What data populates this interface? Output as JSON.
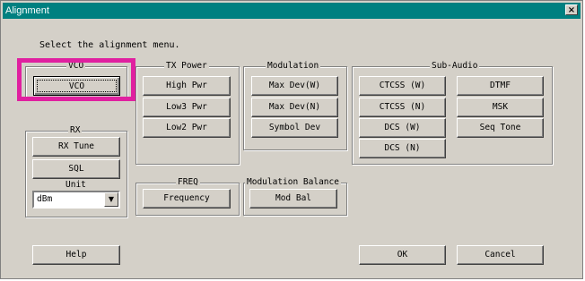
{
  "window": {
    "title": "Alignment",
    "close_glyph": "×"
  },
  "prompt": "Select the alignment menu.",
  "vco": {
    "label": "VCO",
    "button": "VCO"
  },
  "rx": {
    "label": "RX",
    "rx_tune": "RX Tune",
    "sql": "SQL",
    "unit_label": "Unit",
    "unit_value": "dBm"
  },
  "tx_power": {
    "label": "TX Power",
    "high": "High Pwr",
    "low3": "Low3 Pwr",
    "low2": "Low2 Pwr"
  },
  "modulation": {
    "label": "Modulation",
    "max_dev_w": "Max Dev(W)",
    "max_dev_n": "Max Dev(N)",
    "symbol_dev": "Symbol Dev"
  },
  "sub_audio": {
    "label": "Sub-Audio",
    "ctcss_w": "CTCSS (W)",
    "ctcss_n": "CTCSS (N)",
    "dcs_w": "DCS (W)",
    "dcs_n": "DCS (N)",
    "dtmf": "DTMF",
    "msk": "MSK",
    "seq_tone": "Seq Tone"
  },
  "freq": {
    "label": "FREQ",
    "button": "Frequency"
  },
  "mod_balance": {
    "label": "Modulation Balance",
    "button": "Mod Bal"
  },
  "footer": {
    "help": "Help",
    "ok": "OK",
    "cancel": "Cancel"
  },
  "colors": {
    "title_bar": "#008080",
    "dialog_bg": "#d4d0c8",
    "highlight": "#e020a0"
  }
}
